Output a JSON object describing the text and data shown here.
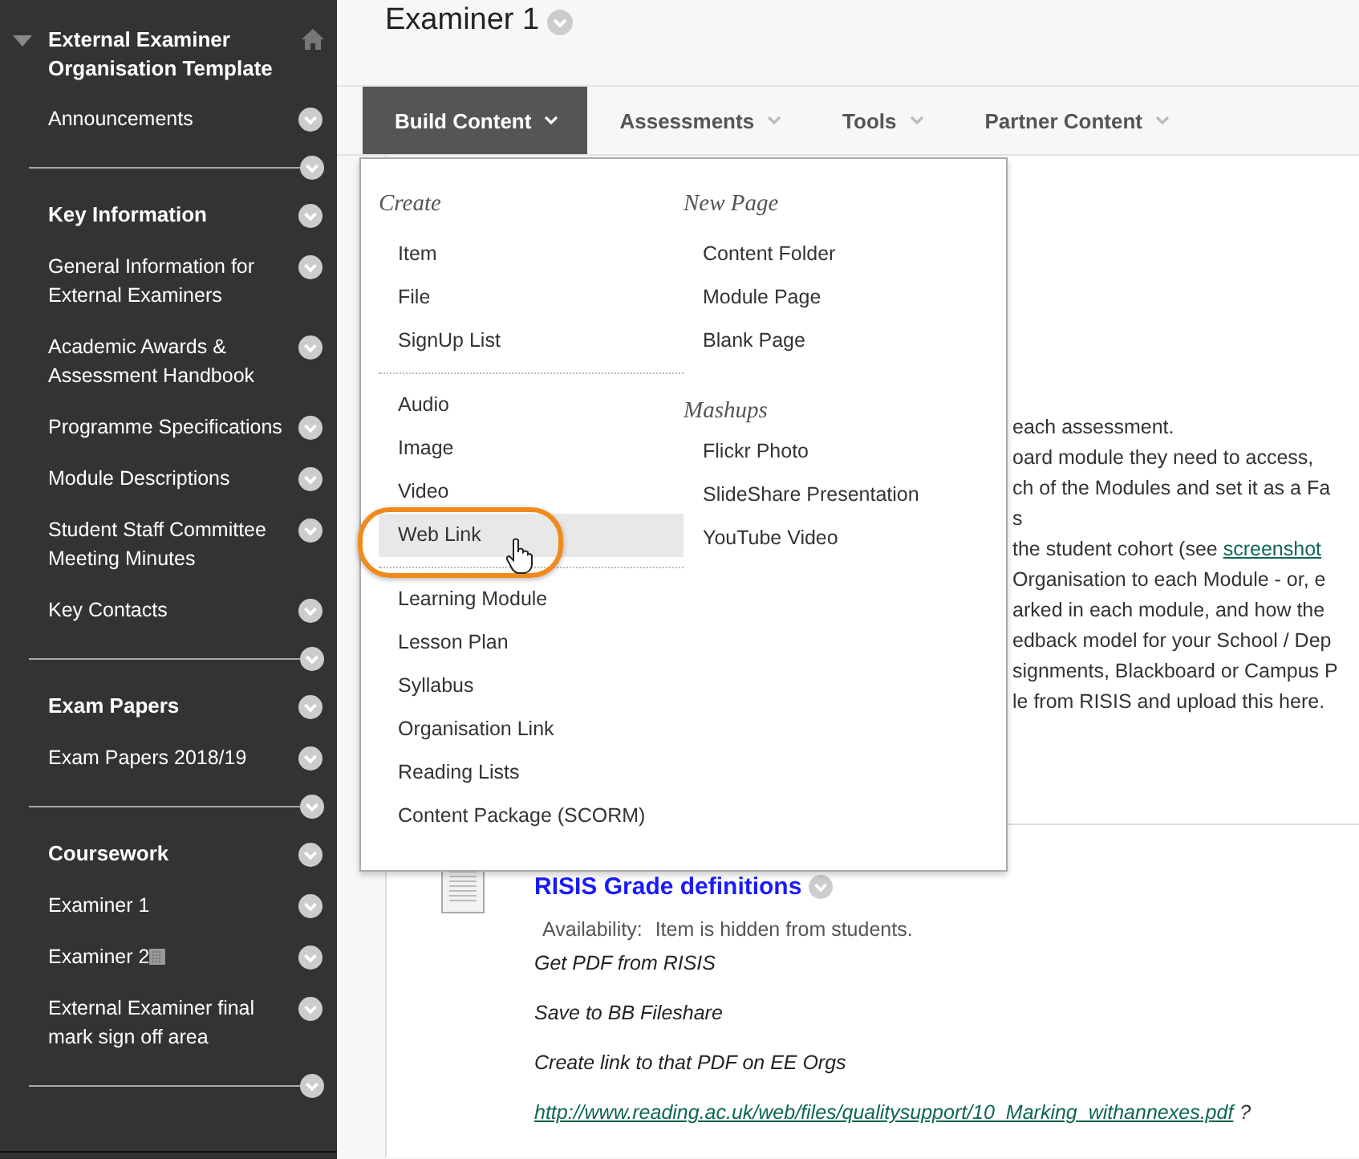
{
  "sidebar": {
    "title": "External Examiner Organisation Template",
    "expanded": true,
    "items": [
      {
        "kind": "link",
        "label": "Announcements"
      },
      {
        "kind": "divider"
      },
      {
        "kind": "heading",
        "label": "Key Information"
      },
      {
        "kind": "link",
        "label": "General Information for External Examiners"
      },
      {
        "kind": "link",
        "label": "Academic Awards & Assessment Handbook"
      },
      {
        "kind": "link",
        "label": "Programme Specifications"
      },
      {
        "kind": "link",
        "label": "Module Descriptions"
      },
      {
        "kind": "link",
        "label": "Student Staff Committee Meeting Minutes"
      },
      {
        "kind": "link",
        "label": "Key Contacts"
      },
      {
        "kind": "divider"
      },
      {
        "kind": "heading",
        "label": "Exam Papers"
      },
      {
        "kind": "link",
        "label": "Exam Papers 2018/19"
      },
      {
        "kind": "divider"
      },
      {
        "kind": "heading",
        "label": "Coursework"
      },
      {
        "kind": "link",
        "label": "Examiner 1"
      },
      {
        "kind": "link",
        "label": "Examiner 2",
        "status_icon": true
      },
      {
        "kind": "link",
        "label": "External Examiner final mark sign off area"
      },
      {
        "kind": "divider"
      }
    ]
  },
  "page_title": "Examiner 1",
  "tabs": [
    {
      "label": "Build Content",
      "selected": true
    },
    {
      "label": "Assessments",
      "selected": false
    },
    {
      "label": "Tools",
      "selected": false
    },
    {
      "label": "Partner Content",
      "selected": false
    }
  ],
  "menu": {
    "columns": [
      [
        {
          "heading": "Create",
          "groups": [
            [
              {
                "label": "Item",
                "selected": false
              },
              {
                "label": "File",
                "selected": false
              },
              {
                "label": "SignUp List",
                "selected": false
              }
            ],
            [
              {
                "label": "Audio",
                "selected": false
              },
              {
                "label": "Image",
                "selected": false
              },
              {
                "label": "Video",
                "selected": false
              },
              {
                "label": "Web Link",
                "selected": true
              }
            ],
            [
              {
                "label": "Learning Module",
                "selected": false
              },
              {
                "label": "Lesson Plan",
                "selected": false
              },
              {
                "label": "Syllabus",
                "selected": false
              },
              {
                "label": "Organisation Link",
                "selected": false
              },
              {
                "label": "Reading Lists",
                "selected": false
              },
              {
                "label": "Content Package (SCORM)",
                "selected": false
              }
            ]
          ]
        }
      ],
      [
        {
          "heading": "New Page",
          "groups": [
            [
              {
                "label": "Content Folder",
                "selected": false
              },
              {
                "label": "Module Page",
                "selected": false
              },
              {
                "label": "Blank Page",
                "selected": false
              }
            ]
          ]
        },
        {
          "heading": "Mashups",
          "groups": [
            [
              {
                "label": "Flickr Photo",
                "selected": false
              },
              {
                "label": "SlideShare Presentation",
                "selected": false
              },
              {
                "label": "YouTube Video",
                "selected": false
              }
            ]
          ]
        }
      ]
    ]
  },
  "content_lines": [
    {
      "text": "each assessment."
    },
    {
      "text": "oard module they need to access,"
    },
    {
      "text": "ch of the Modules and set it as a Fa"
    },
    {
      "text": "s"
    },
    {
      "text": "the student cohort (see ",
      "link": "screenshot"
    },
    {
      "text": "Organisation to each Module - or, e"
    },
    {
      "text": "arked in each module, and how the"
    },
    {
      "text": "edback model for your School / Dep"
    },
    {
      "text": "signments, Blackboard or Campus P"
    },
    {
      "text": "le from RISIS and upload this here."
    }
  ],
  "item": {
    "title": "RISIS Grade definitions",
    "availability_label": "Availability:",
    "availability": "Item is hidden from students.",
    "notes": [
      "Get PDF from RISIS",
      "Save to BB Fileshare",
      "Create link to that PDF on EE Orgs"
    ],
    "url": "http://www.reading.ac.uk/web/files/qualitysupport/10_Marking_withannexes.pdf",
    "url_suffix": "?"
  }
}
